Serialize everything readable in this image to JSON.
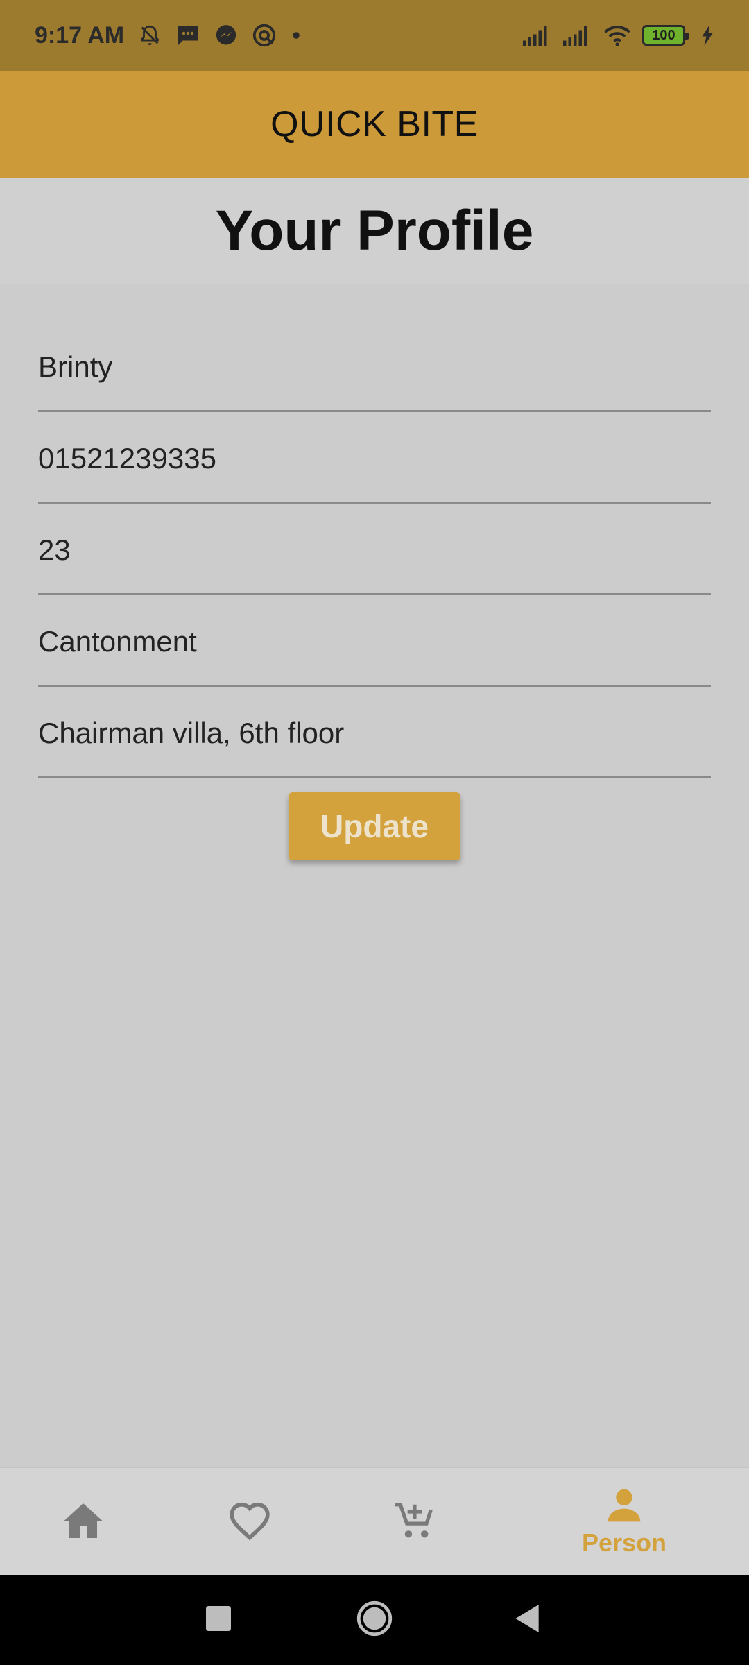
{
  "status_bar": {
    "time": "9:17 AM",
    "battery": "100",
    "icons": [
      "mute-icon",
      "message-icon",
      "messenger-icon",
      "app-icon",
      "dot-icon",
      "signal-icon",
      "signal-icon",
      "wifi-icon",
      "battery-icon",
      "charging-icon"
    ]
  },
  "app_bar": {
    "title": "QUICK BITE"
  },
  "profile": {
    "title": "Your Profile",
    "fields": {
      "name": "Brinty",
      "phone": "01521239335",
      "age": "23",
      "area": "Cantonment",
      "address": "Chairman villa, 6th floor"
    },
    "update_label": "Update"
  },
  "bottom_nav": {
    "items": [
      {
        "icon": "home-icon",
        "label": ""
      },
      {
        "icon": "heart-icon",
        "label": ""
      },
      {
        "icon": "add-cart-icon",
        "label": ""
      },
      {
        "icon": "person-icon",
        "label": "Person",
        "active": true
      }
    ]
  },
  "colors": {
    "status_bar": "#9c7a2e",
    "app_bar": "#cc9a38",
    "accent": "#d4a23c",
    "background": "#cccccc",
    "inactive_icon": "#7a7a7a"
  }
}
